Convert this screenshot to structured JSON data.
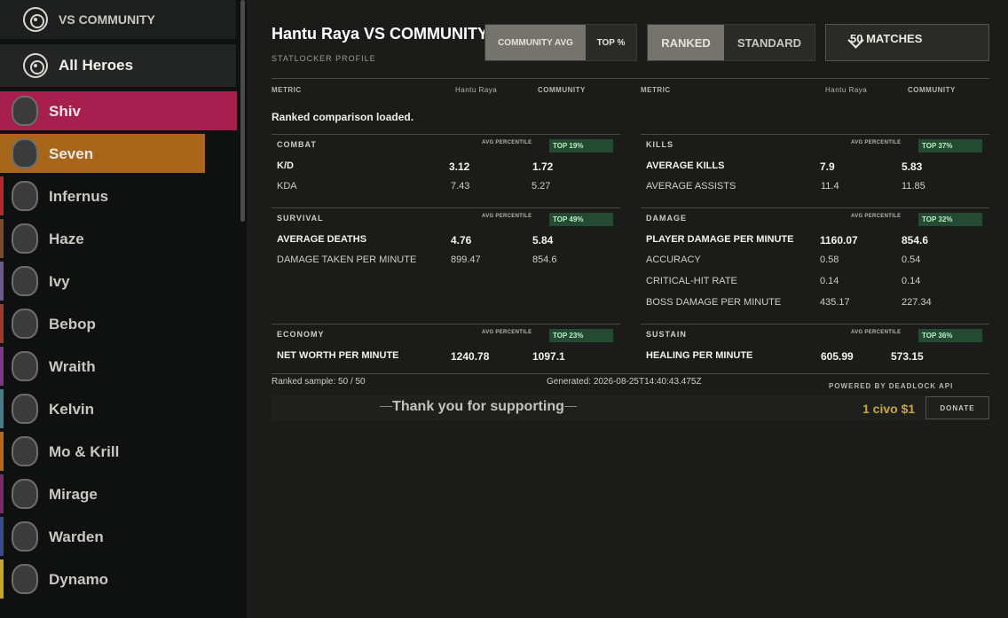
{
  "sidebar": {
    "vs_community": "VS COMMUNITY",
    "all_heroes": "All Heroes",
    "heroes": [
      {
        "name": "Shiv",
        "color": "#a71f4f"
      },
      {
        "name": "Seven",
        "color": "#a8661a"
      },
      {
        "name": "Infernus",
        "color": "#b52a2a"
      },
      {
        "name": "Haze",
        "color": "#7a4a2a"
      },
      {
        "name": "Ivy",
        "color": "#6c5a8a"
      },
      {
        "name": "Bebop",
        "color": "#9a3a2a"
      },
      {
        "name": "Wraith",
        "color": "#7a3a8a"
      },
      {
        "name": "Kelvin",
        "color": "#4a7a8a"
      },
      {
        "name": "Mo & Krill",
        "color": "#b36a1a"
      },
      {
        "name": "Mirage",
        "color": "#7a2a6a"
      },
      {
        "name": "Warden",
        "color": "#3a4a8a"
      },
      {
        "name": "Dynamo",
        "color": "#c8a62a"
      }
    ]
  },
  "header": {
    "title": "Hantu Raya VS COMMUNITY",
    "subtitle": "STATLOCKER PROFILE",
    "community_avg": "COMMUNITY AVG",
    "top_pct": "TOP %",
    "ranked": "RANKED",
    "standard": "STANDARD",
    "matches": "50 MATCHES"
  },
  "columns": {
    "metric": "METRIC",
    "player": "Hantu Raya",
    "community": "COMMUNITY"
  },
  "status": "Ranked comparison loaded.",
  "avg_percentile": "AVG PERCENTILE",
  "cards": {
    "combat": {
      "title": "COMBAT",
      "badge": "TOP 19%",
      "rows": [
        {
          "label": "K/D",
          "player": "3.12",
          "community": "1.72"
        },
        {
          "label": "KDA",
          "player": "7.43",
          "community": "5.27"
        }
      ]
    },
    "kills": {
      "title": "KILLS",
      "badge": "TOP 37%",
      "rows": [
        {
          "label": "AVERAGE KILLS",
          "player": "7.9",
          "community": "5.83"
        },
        {
          "label": "AVERAGE ASSISTS",
          "player": "11.4",
          "community": "11.85"
        }
      ]
    },
    "survival": {
      "title": "SURVIVAL",
      "badge": "TOP 49%",
      "rows": [
        {
          "label": "AVERAGE DEATHS",
          "player": "4.76",
          "community": "5.84"
        },
        {
          "label": "DAMAGE TAKEN PER MINUTE",
          "player": "899.47",
          "community": "854.6"
        }
      ]
    },
    "damage": {
      "title": "DAMAGE",
      "badge": "TOP 32%",
      "rows": [
        {
          "label": "PLAYER DAMAGE PER MINUTE",
          "player": "1160.07",
          "community": "854.6"
        },
        {
          "label": "ACCURACY",
          "player": "0.58",
          "community": "0.54"
        },
        {
          "label": "CRITICAL-HIT RATE",
          "player": "0.14",
          "community": "0.14"
        },
        {
          "label": "BOSS DAMAGE PER MINUTE",
          "player": "435.17",
          "community": "227.34"
        }
      ]
    },
    "economy": {
      "title": "ECONOMY",
      "badge": "TOP 23%",
      "rows": [
        {
          "label": "NET WORTH PER MINUTE",
          "player": "1240.78",
          "community": "1097.1"
        }
      ]
    },
    "sustain": {
      "title": "SUSTAIN",
      "badge": "TOP 36%",
      "rows": [
        {
          "label": "HEALING PER MINUTE",
          "player": "605.99",
          "community": "573.15"
        }
      ]
    }
  },
  "footer": {
    "sample": "Ranked sample: 50 / 50",
    "generated": "Generated: 2026-08-25T14:40:43.475Z",
    "powered": "POWERED BY DEADLOCK API",
    "support": "Thank you for supporting",
    "ad": "1 civo $1",
    "donate": "DONATE"
  }
}
